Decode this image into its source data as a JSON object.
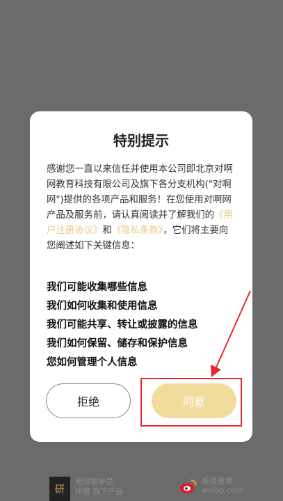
{
  "dialog": {
    "title": "特别提示",
    "intro": "感谢您一直以来信任并使用本公司即北京对啊网教育科技有限公司及旗下各分支机构(\"对啊网\")提供的各项产品和服务！在您使用对啊网产品及服务前，请认真阅读并了解我们的",
    "link_agreement": "《用户注册协议》",
    "and_text": "和",
    "link_privacy": "《隐私条款》",
    "outro": "，它们将主要向您阐述如下关键信息：",
    "list": [
      "我们可能收集哪些信息",
      "我们如何收集和使用信息",
      "我们可能共享、转让或披露的信息",
      "我们如何保留、储存和保护信息",
      "您如何管理个人信息"
    ],
    "reject_label": "拒绝",
    "agree_label": "同意"
  },
  "footer": {
    "logo1_char": "研",
    "logo1_line1": "考研帮学员",
    "logo1_line2": "研帮 旗下产品",
    "weibo_line1": "新浪微博",
    "weibo_line2": "weibo.com"
  },
  "colors": {
    "link": "#e8c88a",
    "agree_button": "#f1dc9d",
    "highlight": "#e52c2c"
  }
}
